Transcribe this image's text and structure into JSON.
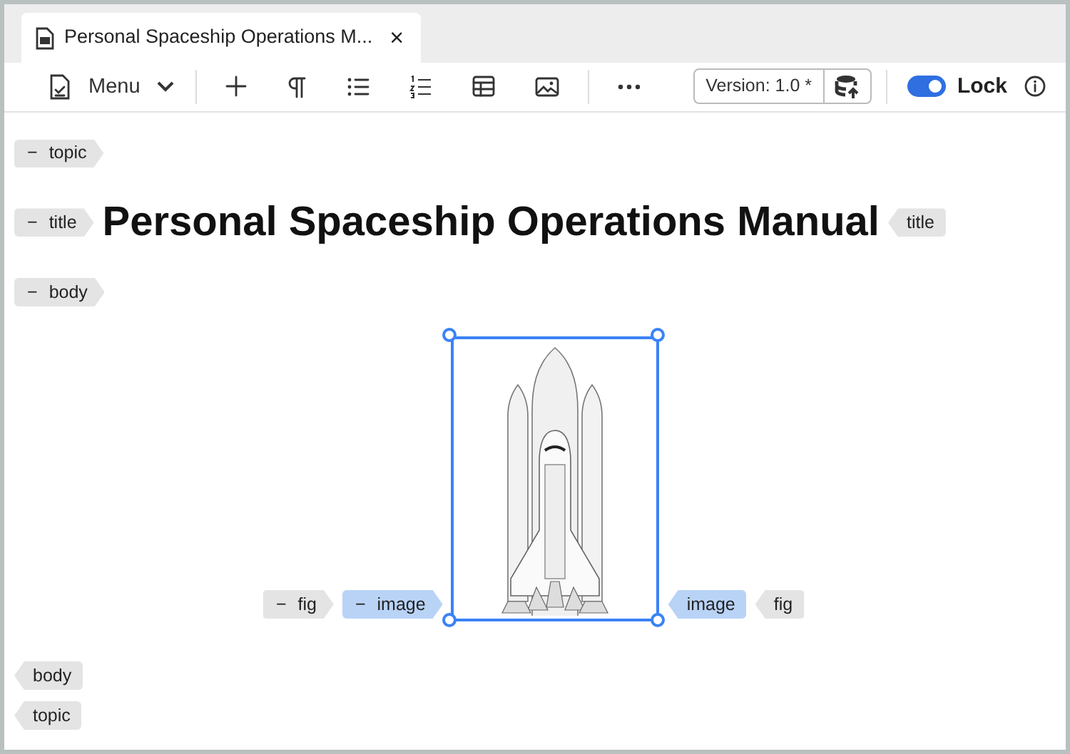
{
  "tab": {
    "title": "Personal Spaceship Operations M...",
    "close": "×"
  },
  "toolbar": {
    "menu": "Menu",
    "version": "Version: 1.0 *",
    "lock": {
      "label": "Lock",
      "on": true
    }
  },
  "document": [
    {
      "kind": "open",
      "label": "topic",
      "toggle": "−",
      "selected": false
    },
    {
      "kind": "heading",
      "open": {
        "label": "title",
        "toggle": "−",
        "selected": false
      },
      "text": "Personal Spaceship Operations Manual",
      "close": {
        "label": "title",
        "selected": false
      }
    },
    {
      "kind": "open",
      "label": "body",
      "toggle": "−",
      "selected": false
    },
    {
      "kind": "figure",
      "items": [
        {
          "kind": "open",
          "label": "fig",
          "toggle": "−",
          "selected": false
        },
        {
          "kind": "open",
          "label": "image",
          "toggle": "−",
          "selected": true
        },
        {
          "kind": "picture",
          "selected": true
        },
        {
          "kind": "close",
          "label": "image",
          "selected": true
        },
        {
          "kind": "close",
          "label": "fig",
          "selected": false
        }
      ]
    },
    {
      "kind": "close",
      "label": "body",
      "selected": false
    },
    {
      "kind": "close",
      "label": "topic",
      "selected": false
    }
  ]
}
